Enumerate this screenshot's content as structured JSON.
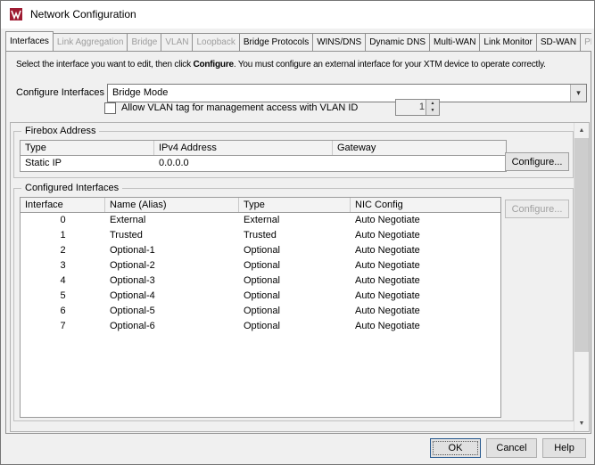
{
  "window": {
    "title": "Network Configuration"
  },
  "tabs": [
    {
      "label": "Interfaces",
      "state": "active"
    },
    {
      "label": "Link Aggregation",
      "state": "disabled"
    },
    {
      "label": "Bridge",
      "state": "disabled"
    },
    {
      "label": "VLAN",
      "state": "disabled"
    },
    {
      "label": "Loopback",
      "state": "disabled"
    },
    {
      "label": "Bridge Protocols",
      "state": "enabled"
    },
    {
      "label": "WINS/DNS",
      "state": "enabled"
    },
    {
      "label": "Dynamic DNS",
      "state": "enabled"
    },
    {
      "label": "Multi-WAN",
      "state": "enabled"
    },
    {
      "label": "Link Monitor",
      "state": "enabled"
    },
    {
      "label": "SD-WAN",
      "state": "enabled"
    },
    {
      "label": "PPPoE",
      "state": "disabled"
    }
  ],
  "intro": {
    "text1": "Select the interface you want to edit, then click ",
    "bold": "Configure",
    "text2": ". You must configure an external interface for your XTM device to operate correctly."
  },
  "mode": {
    "label": "Configure Interfaces in",
    "value": "Bridge Mode"
  },
  "vlan": {
    "label": "Allow VLAN tag for management access with VLAN ID",
    "value": "1",
    "checked": false
  },
  "firebox": {
    "title": "Firebox Address",
    "columns": [
      "Type",
      "IPv4 Address",
      "Gateway"
    ],
    "rows": [
      [
        "Static IP",
        "0.0.0.0",
        ""
      ]
    ],
    "configure": "Configure..."
  },
  "interfaces": {
    "title": "Configured Interfaces",
    "columns": [
      "Interface",
      "Name (Alias)",
      "Type",
      "NIC Config"
    ],
    "rows": [
      [
        "0",
        "External",
        "External",
        "Auto Negotiate"
      ],
      [
        "1",
        "Trusted",
        "Trusted",
        "Auto Negotiate"
      ],
      [
        "2",
        "Optional-1",
        "Optional",
        "Auto Negotiate"
      ],
      [
        "3",
        "Optional-2",
        "Optional",
        "Auto Negotiate"
      ],
      [
        "4",
        "Optional-3",
        "Optional",
        "Auto Negotiate"
      ],
      [
        "5",
        "Optional-4",
        "Optional",
        "Auto Negotiate"
      ],
      [
        "6",
        "Optional-5",
        "Optional",
        "Auto Negotiate"
      ],
      [
        "7",
        "Optional-6",
        "Optional",
        "Auto Negotiate"
      ]
    ],
    "configure": "Configure..."
  },
  "footer": {
    "ok": "OK",
    "cancel": "Cancel",
    "help": "Help"
  },
  "colors": {
    "logo_red": "#9e1b32",
    "focus_blue": "#26588e",
    "dialog_bg": "#f0f0f0"
  }
}
